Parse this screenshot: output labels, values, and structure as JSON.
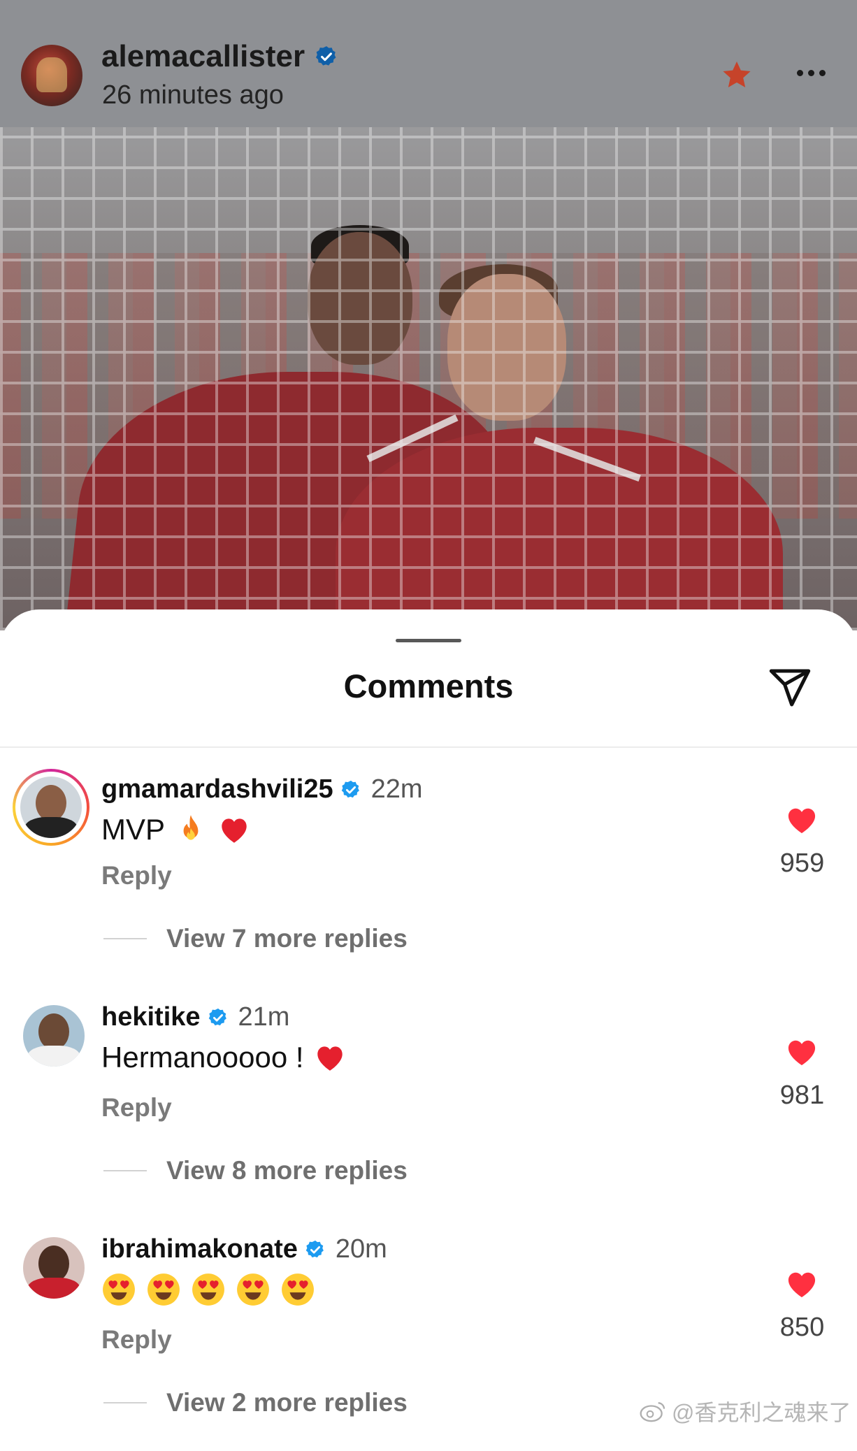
{
  "post": {
    "username": "alemacallister",
    "time": "26 minutes ago"
  },
  "sheet": {
    "title": "Comments"
  },
  "comments": [
    {
      "username": "gmamardashvili25",
      "time": "22m",
      "text": "MVP",
      "emojis": [
        "fire-emoji",
        "red-heart-emoji"
      ],
      "reply_label": "Reply",
      "more_replies": "View 7 more replies",
      "likes": "959"
    },
    {
      "username": "hekitike",
      "time": "21m",
      "text": "Hermanooooo !",
      "emojis": [
        "red-heart-emoji"
      ],
      "reply_label": "Reply",
      "more_replies": "View 8 more replies",
      "likes": "981"
    },
    {
      "username": "ibrahimakonate",
      "time": "20m",
      "text": "",
      "emojis": [
        "heart-eyes-emoji",
        "heart-eyes-emoji",
        "heart-eyes-emoji",
        "heart-eyes-emoji",
        "heart-eyes-emoji"
      ],
      "reply_label": "Reply",
      "more_replies": "View 2 more replies",
      "likes": "850"
    }
  ],
  "watermark": "@香克利之魂来了",
  "colors": {
    "verified": "#1d9bf0",
    "like_heart": "#ff3040",
    "star": "#e8502a"
  }
}
